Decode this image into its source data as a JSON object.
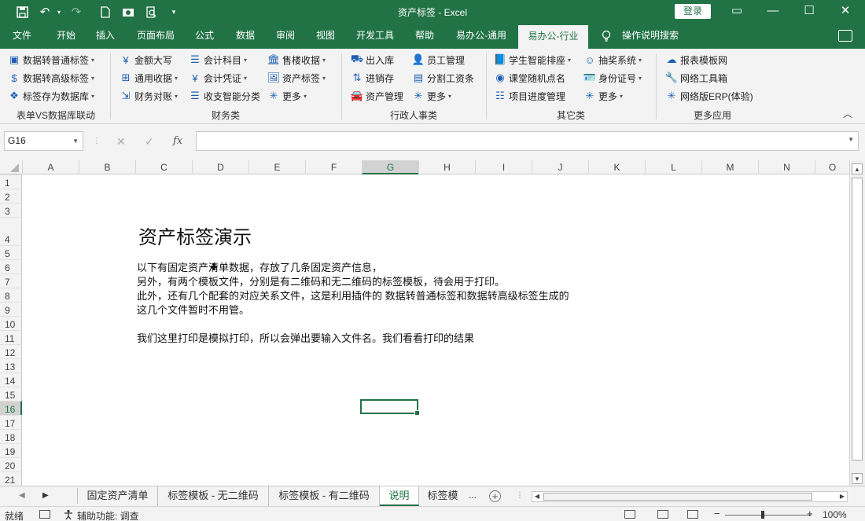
{
  "titlebar": {
    "title": "资产标签  -  Excel",
    "login": "登录",
    "minimize": "—",
    "maximize": "☐",
    "close": "✕",
    "ribbon_display": "▭"
  },
  "quick_access": {
    "save": "💾",
    "undo": "↶",
    "redo": "↷",
    "customize": "▾"
  },
  "tabs": [
    "文件",
    "开始",
    "插入",
    "页面布局",
    "公式",
    "数据",
    "审阅",
    "视图",
    "开发工具",
    "帮助",
    "易办公-通用",
    "易办公-行业",
    "操作说明搜索"
  ],
  "ribbon": {
    "groups": [
      {
        "label": "表单VS数据库联动",
        "items": [
          {
            "label": "数据转普通标签",
            "icon": "label-icon",
            "glyph": "▣"
          },
          {
            "label": "数据转高级标签",
            "icon": "dollar-icon",
            "glyph": "$"
          },
          {
            "label": "标签存为数据库",
            "icon": "diamond-icon",
            "glyph": "❖"
          }
        ]
      },
      {
        "label": "财务类",
        "items": [
          {
            "label": "金额大写",
            "icon": "yen-icon",
            "glyph": "¥"
          },
          {
            "label": "通用收据",
            "icon": "receipt-icon",
            "glyph": "⊞"
          },
          {
            "label": "财务对账",
            "icon": "arrows-icon",
            "glyph": "⇲"
          },
          {
            "label": "会计科目",
            "icon": "list-icon",
            "glyph": "☰"
          },
          {
            "label": "会计凭证",
            "icon": "yen-icon",
            "glyph": "¥"
          },
          {
            "label": "收支智能分类",
            "icon": "list-icon",
            "glyph": "☰"
          },
          {
            "label": "售楼收据",
            "icon": "bank-icon",
            "glyph": "🏛"
          },
          {
            "label": "资产标签",
            "icon": "image-icon",
            "glyph": "🖼"
          },
          {
            "label": "更多",
            "icon": "sparkle-icon",
            "glyph": "✳"
          }
        ]
      },
      {
        "label": "行政人事类",
        "items": [
          {
            "label": "出入库",
            "icon": "truck-icon",
            "glyph": "⛟"
          },
          {
            "label": "进销存",
            "icon": "swap-icon",
            "glyph": "⇅"
          },
          {
            "label": "资产管理",
            "icon": "car-icon",
            "glyph": "🚘"
          },
          {
            "label": "员工管理",
            "icon": "person-icon",
            "glyph": "👤"
          },
          {
            "label": "分割工资条",
            "icon": "money-icon",
            "glyph": "▤"
          },
          {
            "label": "更多",
            "icon": "sparkle-icon",
            "glyph": "✳"
          }
        ]
      },
      {
        "label": "其它类",
        "items": [
          {
            "label": "学生智能排座",
            "icon": "book-icon",
            "glyph": "📘"
          },
          {
            "label": "课堂随机点名",
            "icon": "circle-icon",
            "glyph": "◉"
          },
          {
            "label": "项目进度管理",
            "icon": "progress-icon",
            "glyph": "☷"
          },
          {
            "label": "抽奖系统",
            "icon": "robot-icon",
            "glyph": "☺"
          },
          {
            "label": "身份证号",
            "icon": "id-card-icon",
            "glyph": "🪪"
          },
          {
            "label": "更多",
            "icon": "sparkle-icon",
            "glyph": "✳"
          }
        ]
      },
      {
        "label": "更多应用",
        "items": [
          {
            "label": "报表模板网",
            "icon": "cloud-icon",
            "glyph": "☁"
          },
          {
            "label": "网络工具箱",
            "icon": "wrench-icon",
            "glyph": "🔧"
          },
          {
            "label": "网络版ERP(体验)",
            "icon": "sparkle-icon",
            "glyph": "✳"
          }
        ]
      }
    ],
    "collapse": "︿"
  },
  "formula_bar": {
    "name_box": "G16",
    "cancel": "✕",
    "enter": "✓",
    "fx": "fx",
    "formula": ""
  },
  "columns": [
    "A",
    "B",
    "C",
    "D",
    "E",
    "F",
    "G",
    "H",
    "I",
    "J",
    "K",
    "L",
    "M",
    "N",
    "O"
  ],
  "selected_column": "G",
  "rows": [
    "1",
    "2",
    "3",
    "4",
    "5",
    "6",
    "7",
    "8",
    "9",
    "10",
    "11",
    "12",
    "13",
    "14",
    "15",
    "16",
    "17",
    "18",
    "19",
    "20",
    "21"
  ],
  "selected_row": "16",
  "sheet": {
    "title": "资产标签演示",
    "lines": [
      "以下有固定资产清单数据，存放了几条固定资产信息，",
      "另外，有两个模板文件，分别是有二维码和无二维码的标签模板，待会用于打印。",
      "此外，还有几个配套的对应关系文件，这是利用插件的 数据转普通标签和数据转高级标签生成的",
      "这几个文件暂时不用管。",
      "我们这里打印是模拟打印，所以会弹出要输入文件名。我们看看打印的结果"
    ]
  },
  "sheet_tabs": {
    "tabs": [
      "固定资产清单",
      "标签模板 - 无二维码",
      "标签模板 - 有二维码",
      "说明",
      "标签模"
    ],
    "active": "说明",
    "overflow": "...",
    "add": "+"
  },
  "status": {
    "ready": "就绪",
    "accessibility": "辅助功能: 调查",
    "zoom": "100%",
    "zoom_minus": "−",
    "zoom_plus": "+"
  }
}
